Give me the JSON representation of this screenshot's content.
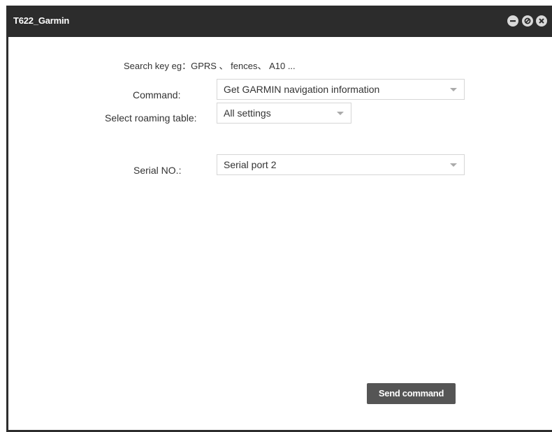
{
  "window": {
    "title": "T622_Garmin"
  },
  "titlebar_buttons": {
    "minimize": "minimize-icon",
    "restore": "restore-icon",
    "close": "close-icon"
  },
  "form": {
    "hint": "Search key eg：GPRS 、 fences、 A10 ...",
    "command": {
      "label": "Command:",
      "value": "Get GARMIN navigation information"
    },
    "roaming_table": {
      "label": "Select roaming table:",
      "value": "All settings"
    },
    "serial": {
      "label": "Serial NO.:",
      "value": "Serial port 2"
    }
  },
  "actions": {
    "send_label": "Send command"
  },
  "colors": {
    "titlebar": "#2c2c2c",
    "button": "#555555",
    "window_bg": "#ffffff"
  }
}
